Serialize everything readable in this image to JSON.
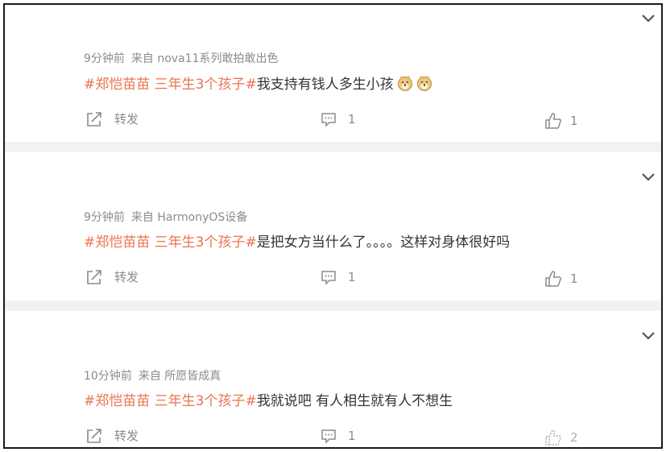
{
  "posts": [
    {
      "time": "9分钟前",
      "source": "来自 nova11系列敢拍敢出色",
      "topic": "#郑恺苗苗 三年生3个孩子#",
      "text": "我支持有钱人多生小孩",
      "emojis": [
        "doge-emoji",
        "doge-emoji"
      ],
      "repost_label": "转发",
      "comment_count": "1",
      "like_count": "1"
    },
    {
      "time": "9分钟前",
      "source": "来自 HarmonyOS设备",
      "topic": "#郑恺苗苗 三年生3个孩子#",
      "text": "是把女方当什么了。。。。这样对身体很好吗",
      "emojis": [],
      "repost_label": "转发",
      "comment_count": "1",
      "like_count": "1"
    },
    {
      "time": "10分钟前",
      "source": "来自 所愿皆成真",
      "topic": "#郑恺苗苗 三年生3个孩子#",
      "text": "我就说吧 有人相生就有人不想生",
      "emojis": [],
      "repost_label": "转发",
      "comment_count": "1",
      "like_count": "2"
    }
  ],
  "colors": {
    "topic": "#eb7350",
    "text": "#333333",
    "meta": "#8b8b8b",
    "separator": "#f2f2f2"
  }
}
